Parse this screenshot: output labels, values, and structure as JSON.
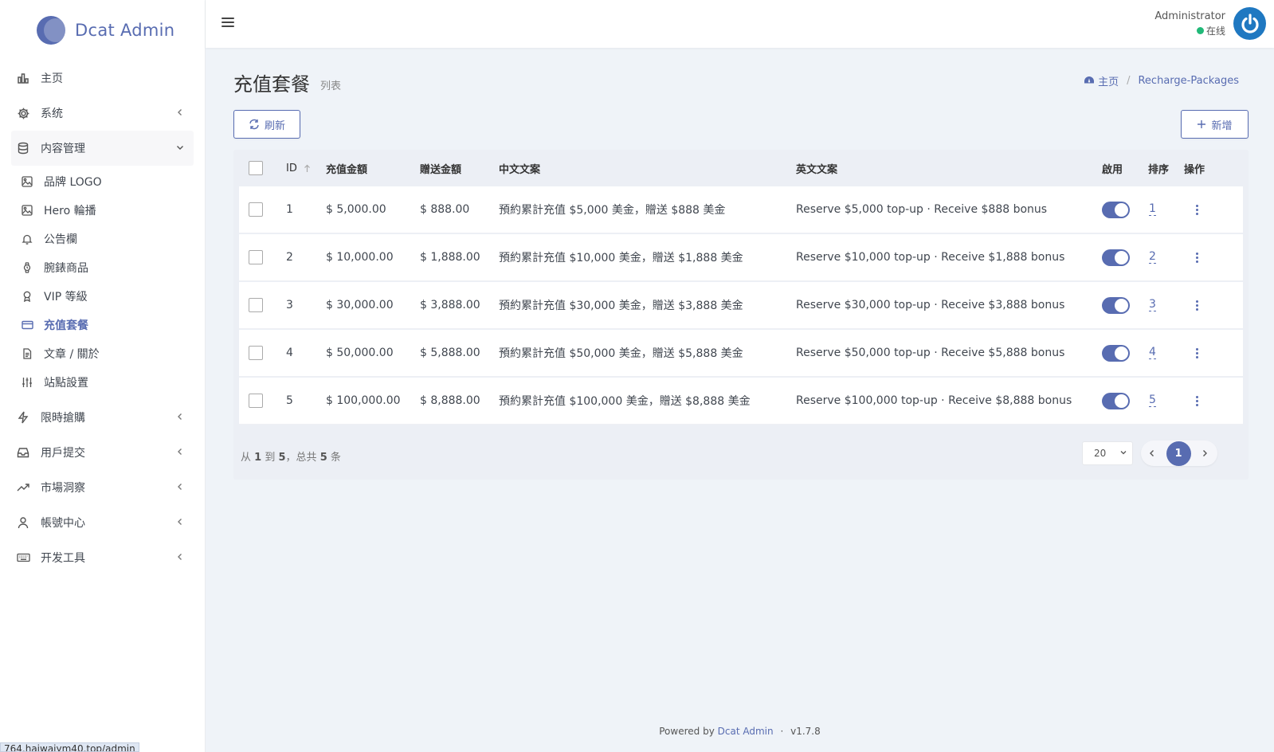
{
  "brand": {
    "name": "Dcat Admin"
  },
  "sidebar": {
    "items": [
      {
        "label": "主页",
        "icon": "bar-chart-icon",
        "has_arrow": false
      },
      {
        "label": "系统",
        "icon": "gear-icon",
        "has_arrow": true
      },
      {
        "label": "内容管理",
        "icon": "database-icon",
        "has_arrow": true,
        "open": true
      }
    ],
    "sub_items": [
      {
        "label": "品牌 LOGO",
        "icon": "image-icon"
      },
      {
        "label": "Hero 輪播",
        "icon": "image-icon"
      },
      {
        "label": "公告欄",
        "icon": "bell-icon"
      },
      {
        "label": "腕錶商品",
        "icon": "watch-icon"
      },
      {
        "label": "VIP 等級",
        "icon": "award-icon"
      },
      {
        "label": "充值套餐",
        "icon": "card-icon",
        "active": true
      },
      {
        "label": "文章 / 關於",
        "icon": "file-icon"
      },
      {
        "label": "站點設置",
        "icon": "sliders-icon"
      }
    ],
    "items_after": [
      {
        "label": "限時搶購",
        "icon": "lightning-icon"
      },
      {
        "label": "用戶提交",
        "icon": "inbox-icon"
      },
      {
        "label": "市場洞察",
        "icon": "trending-icon"
      },
      {
        "label": "帳號中心",
        "icon": "user-icon"
      },
      {
        "label": "开发工具",
        "icon": "keyboard-icon"
      }
    ]
  },
  "header": {
    "user_name": "Administrator",
    "user_status": "在线",
    "status_color": "#21b978"
  },
  "page": {
    "title": "充值套餐",
    "subtitle": "列表",
    "breadcrumb_home": "主页",
    "breadcrumb_current": "Recharge-Packages"
  },
  "toolbar": {
    "refresh_label": "刷新",
    "new_label": "新增"
  },
  "table": {
    "headers": {
      "id": "ID",
      "amount": "充值金額",
      "bonus": "贈送金額",
      "zh_copy": "中文文案",
      "en_copy": "英文文案",
      "enabled": "啟用",
      "order": "排序",
      "actions": "操作"
    },
    "rows": [
      {
        "id": "1",
        "amount": "$ 5,000.00",
        "bonus": "$ 888.00",
        "zh": "預約累計充值 $5,000 美金，贈送 $888 美金",
        "en": "Reserve $5,000 top-up · Receive $888 bonus",
        "enabled": true,
        "order": "1"
      },
      {
        "id": "2",
        "amount": "$ 10,000.00",
        "bonus": "$ 1,888.00",
        "zh": "預約累計充值 $10,000 美金，贈送 $1,888 美金",
        "en": "Reserve $10,000 top-up · Receive $1,888 bonus",
        "enabled": true,
        "order": "2"
      },
      {
        "id": "3",
        "amount": "$ 30,000.00",
        "bonus": "$ 3,888.00",
        "zh": "預約累計充值 $30,000 美金，贈送 $3,888 美金",
        "en": "Reserve $30,000 top-up · Receive $3,888 bonus",
        "enabled": true,
        "order": "3"
      },
      {
        "id": "4",
        "amount": "$ 50,000.00",
        "bonus": "$ 5,888.00",
        "zh": "預約累計充值 $50,000 美金，贈送 $5,888 美金",
        "en": "Reserve $50,000 top-up · Receive $5,888 bonus",
        "enabled": true,
        "order": "4"
      },
      {
        "id": "5",
        "amount": "$ 100,000.00",
        "bonus": "$ 8,888.00",
        "zh": "預約累計充值 $100,000 美金，贈送 $8,888 美金",
        "en": "Reserve $100,000 top-up · Receive $8,888 bonus",
        "enabled": true,
        "order": "5"
      }
    ]
  },
  "pagination": {
    "summary_prefix": "从",
    "from": "1",
    "summary_to": "到",
    "to": "5",
    "summary_total_prefix": "，总共",
    "total": "5",
    "summary_suffix": "条",
    "per_page": "20",
    "current_page": "1"
  },
  "footer": {
    "powered_by": "Powered by",
    "link": "Dcat Admin",
    "separator": "·",
    "version": "v1.7.8"
  },
  "status_bar_url": "764.haiwaiym40.top/admin",
  "colors": {
    "accent": "#586cb1",
    "toggle_on": "#586cb1",
    "background": "#eff3f8"
  }
}
